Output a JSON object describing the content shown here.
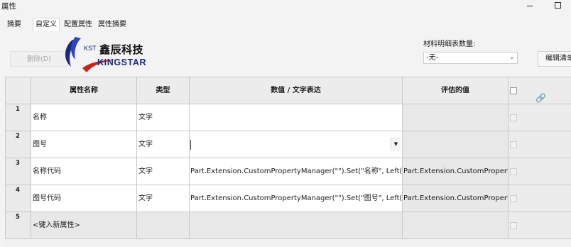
{
  "window": {
    "title": "属性"
  },
  "tabs": [
    {
      "label": "摘要"
    },
    {
      "label": "自定义"
    },
    {
      "label": "配置属性"
    },
    {
      "label": "属性摘要"
    }
  ],
  "toolbar": {
    "delete_label": "删除(D)",
    "edit_list_label": "编辑清单"
  },
  "logo": {
    "kst": "KST",
    "cn": "鑫辰科技",
    "en": "KINGSTAR"
  },
  "bom": {
    "label": "材料明细表数量:",
    "value": "-无-"
  },
  "table": {
    "headers": {
      "name": "属性名称",
      "type": "类型",
      "value": "数值 / 文字表达",
      "evaluated": "评估的值"
    },
    "rows": [
      {
        "num": "1",
        "name": "名称",
        "type": "文字",
        "value": "",
        "evaluated": ""
      },
      {
        "num": "2",
        "name": "图号",
        "type": "文字",
        "value": "",
        "evaluated": ""
      },
      {
        "num": "3",
        "name": "名称代码",
        "type": "文字",
        "value": "Part.Extension.CustomPropertyManager(\"\").Set(\"名称\", Left(Right(Part.GetT",
        "evaluated": "Part.Extension.CustomPropertyMana"
      },
      {
        "num": "4",
        "name": "图号代码",
        "type": "文字",
        "value": "Part.Extension.CustomPropertyManager(\"\").Set(\"图号\", Left(Part.GetTitle, In",
        "evaluated": "Part.Extension.CustomPropertyMana"
      },
      {
        "num": "5",
        "name": "<键入新属性>",
        "type": "",
        "value": "",
        "evaluated": ""
      }
    ]
  },
  "colors": {
    "logo_blue": "#1b2a7e",
    "logo_red": "#c8241f"
  }
}
